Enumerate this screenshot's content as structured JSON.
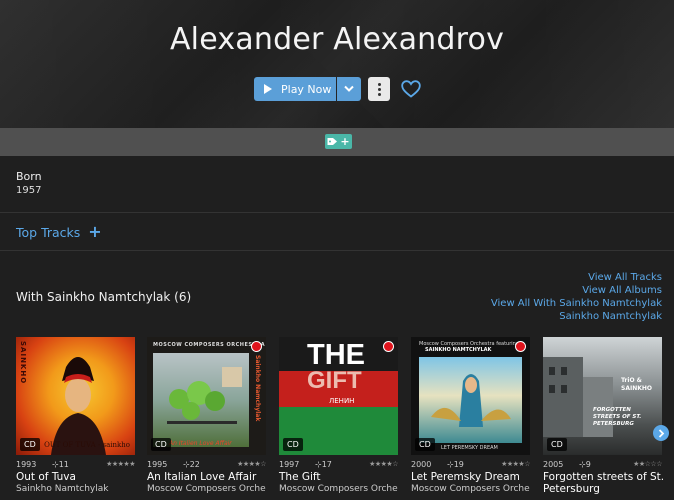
{
  "artist": {
    "name": "Alexander Alexandrov"
  },
  "controls": {
    "play_label": "Play Now"
  },
  "born": {
    "label": "Born",
    "value": "1957"
  },
  "top_tracks": {
    "label": "Top Tracks"
  },
  "collab": {
    "heading": "With Sainkho Namtchylak (6)"
  },
  "view_links": [
    "View All Tracks",
    "View All Albums",
    "View All With Sainkho Namtchylak",
    "Sainkho Namtchylak"
  ],
  "albums": [
    {
      "title": "Out of Tuva",
      "artist": "Sainkho Namtchylak",
      "year": "1993",
      "plays": "⊹11",
      "stars": "★★★★★",
      "format": "CD",
      "cover_top": "OUT OF TUVA - sainkho",
      "cover_side": "SAINKHO"
    },
    {
      "title": "An Italian Love Affair",
      "artist": "Moscow Composers Orchestra",
      "year": "1995",
      "plays": "⊹22",
      "stars": "★★★★☆",
      "format": "CD",
      "cover_top": "MOSCOW COMPOSERS ORCHESTRA",
      "cover_side": "Sainkho Namchylak",
      "cover_bottom": "An Italien Love Affair"
    },
    {
      "title": "The Gift",
      "artist": "Moscow Composers Orchestra",
      "year": "1997",
      "plays": "⊹17",
      "stars": "★★★★☆",
      "format": "CD",
      "cover_top": "THE",
      "cover_mid": "GIFT",
      "cover_small": "ЛЕНИН"
    },
    {
      "title": "Let Peremsky Dream",
      "artist": "Moscow Composers Orchestra",
      "year": "2000",
      "plays": "⊹19",
      "stars": "★★★★☆",
      "format": "CD",
      "cover_top": "Moscow Composers Orchestra featuring",
      "cover_sub": "SAINKHO NAMTCHYLAK",
      "cover_bottom": "LET PEREMSKY DREAM"
    },
    {
      "title": "Forgotten streets of St. Petersburg",
      "artist": "",
      "year": "2005",
      "plays": "⊹9",
      "stars": "★★☆☆☆",
      "format": "CD",
      "cover_top": "TriO & SAINKHO",
      "cover_bottom": "FORGOTTEN STREETS OF ST. PETERSBURG"
    }
  ],
  "colors": {
    "accent": "#5ba8e8",
    "play_button": "#5b9fd8",
    "tag": "#4ab7a8"
  }
}
